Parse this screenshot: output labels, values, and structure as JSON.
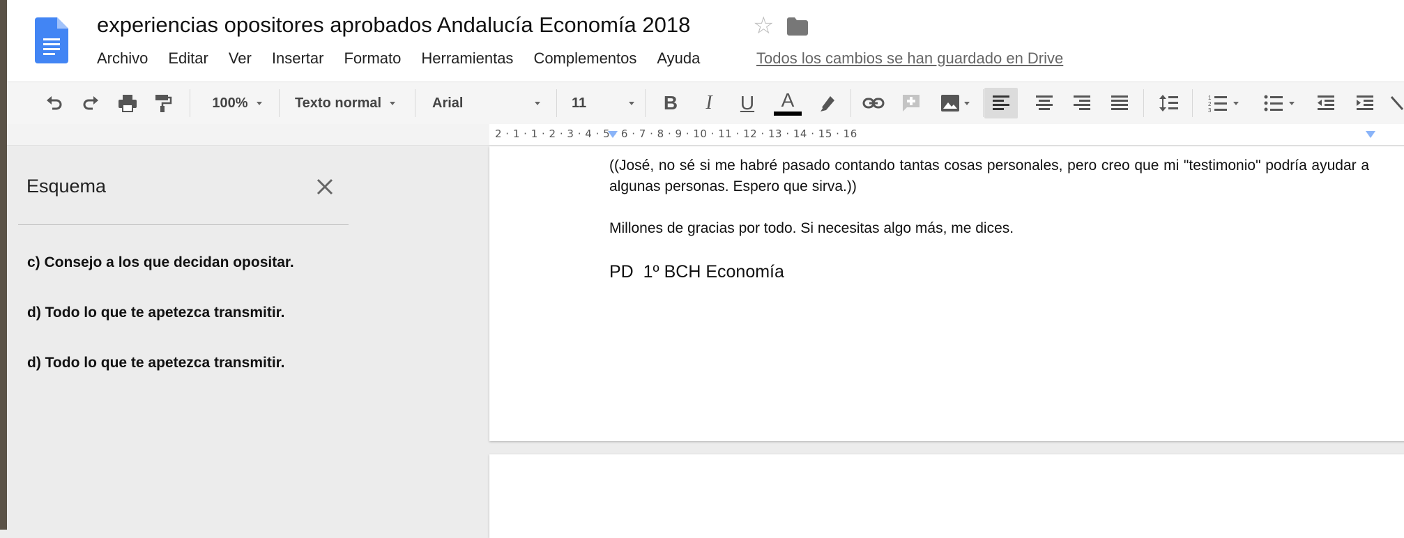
{
  "document": {
    "title": "experiencias opositores aprobados Andalucía Economía 2018",
    "save_status": "Todos los cambios se han guardado en Drive"
  },
  "menu": [
    "Archivo",
    "Editar",
    "Ver",
    "Insertar",
    "Formato",
    "Herramientas",
    "Complementos",
    "Ayuda"
  ],
  "toolbar": {
    "zoom": "100%",
    "style": "Texto normal",
    "font": "Arial",
    "font_size": "11",
    "bold": "B",
    "italic": "I",
    "underline": "U",
    "text_color": "A",
    "text_color_value": "#000000",
    "alignment": "left"
  },
  "ruler": {
    "labels": "2 · 1 · 1 · 2 · 3 · 4 · 5 · 6 · 7 · 8 · 9 · 10 · 11 · 12 · 13 · 14 · 15 · 16"
  },
  "outline": {
    "title": "Esquema",
    "items": [
      "c) Consejo a los que decidan opositar.",
      "d) Todo lo que te apetezca transmitir.",
      "d) Todo lo que te apetezca transmitir."
    ]
  },
  "page": {
    "paragraph1": "((José, no sé si me habré pasado contando tantas cosas personales, pero creo que mi \"testimonio\" podría ayudar a algunas personas. Espero que sirva.))",
    "paragraph2": "Millones de gracias por todo. Si necesitas algo más, me dices.",
    "signature": "PD  1º BCH Economía"
  },
  "colors": {
    "docs_blue": "#4285f4",
    "accent_marker": "#8ab4f8"
  }
}
